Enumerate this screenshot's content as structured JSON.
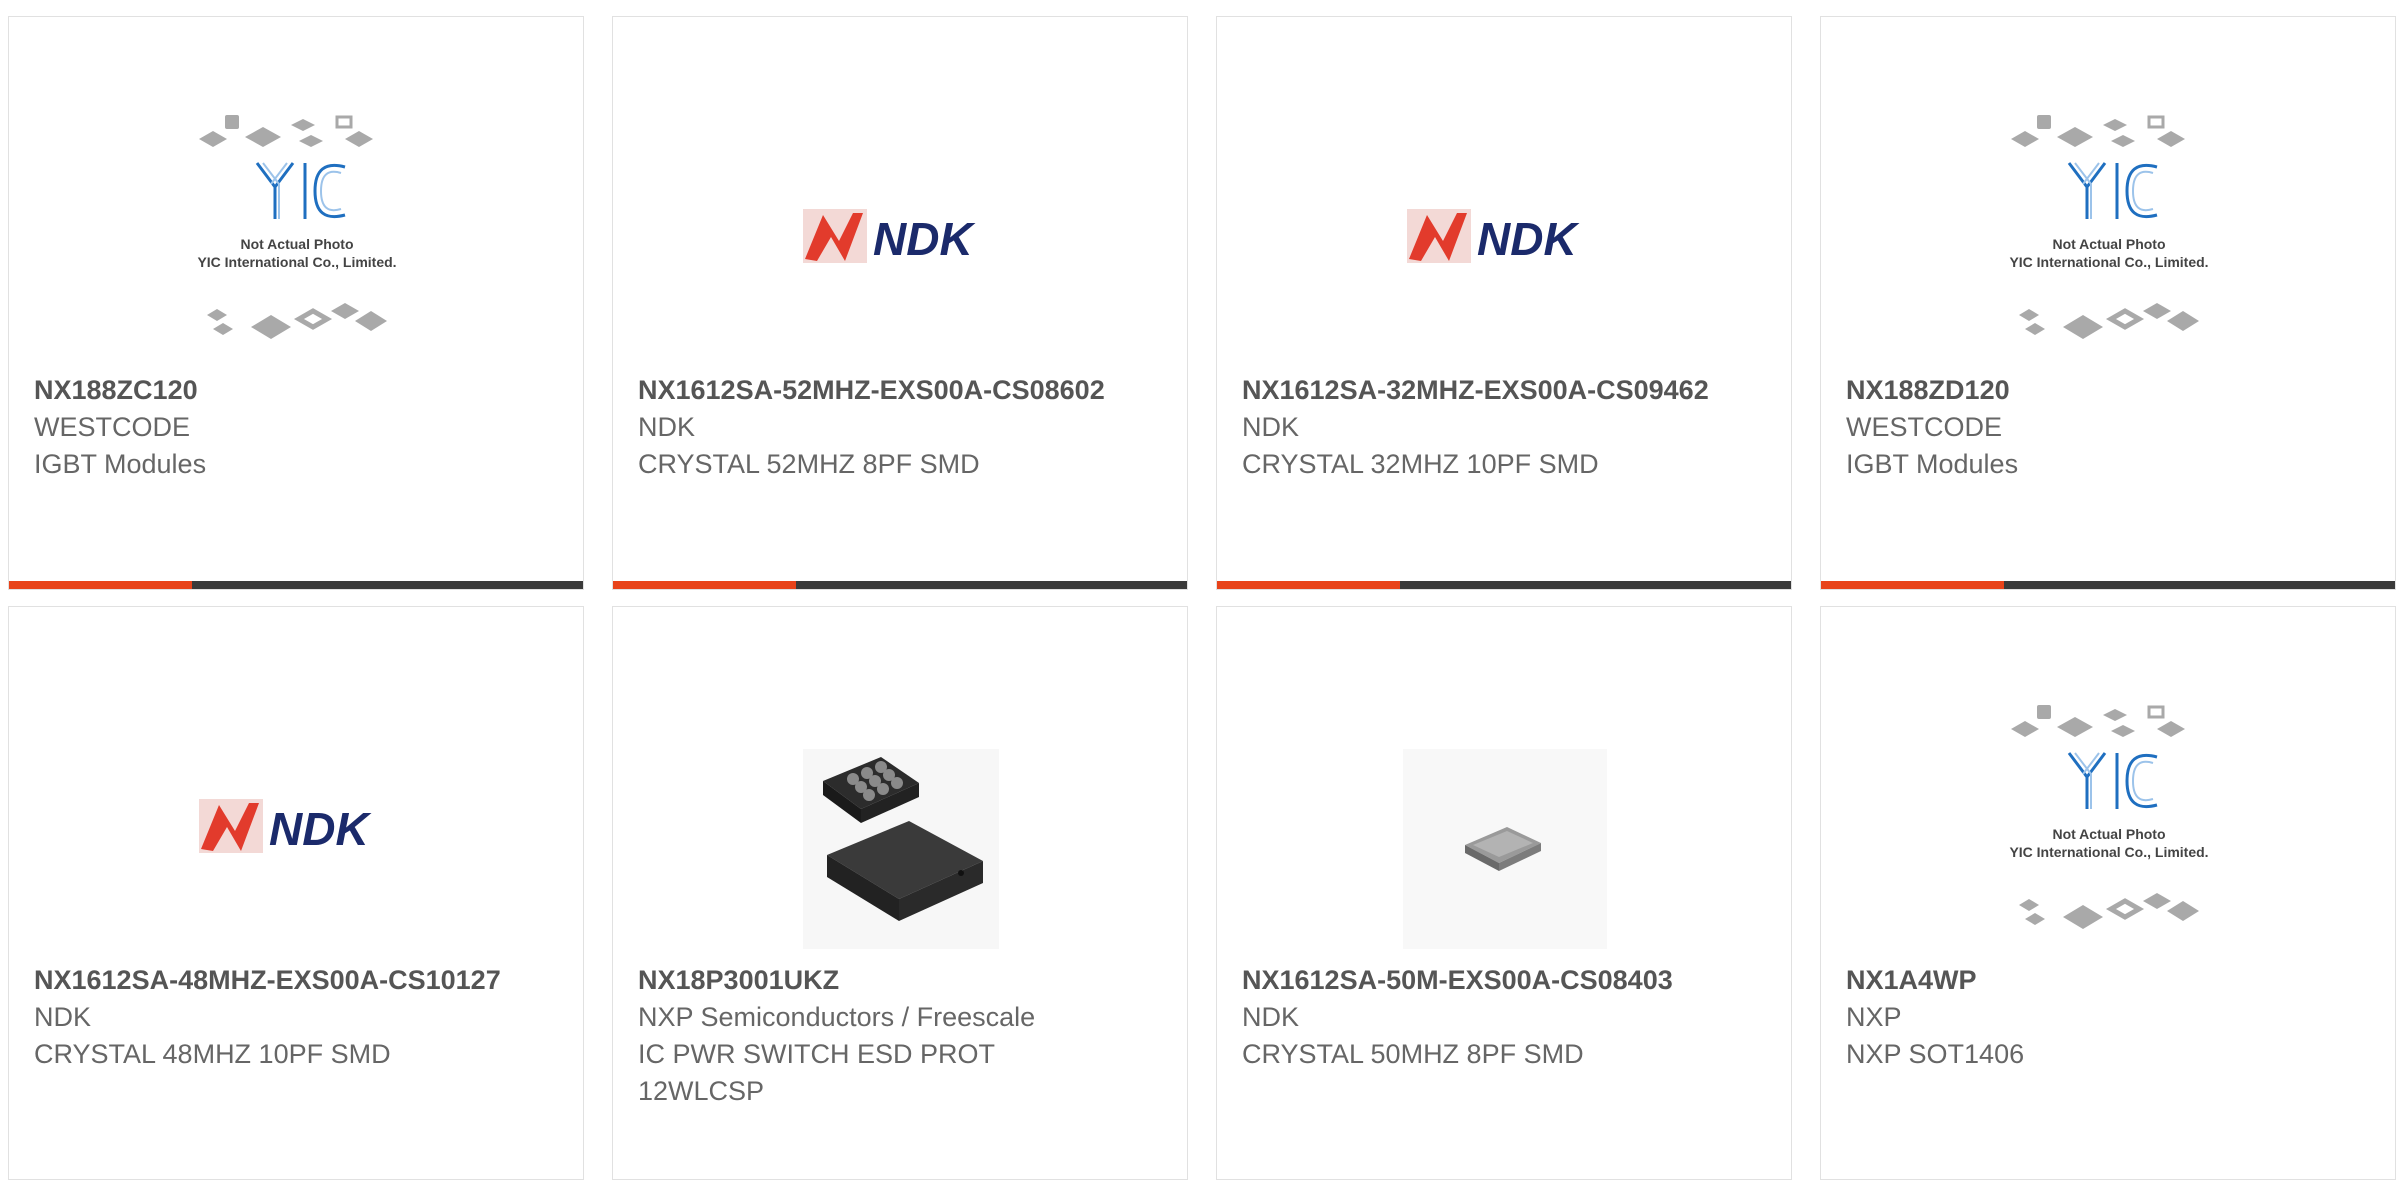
{
  "colors": {
    "accent": "#e8431a",
    "bar": "#3a3a3a",
    "border": "#e1e1e1",
    "text": "#555555",
    "ndk_red": "#e23b2c",
    "ndk_navy": "#1b2a6b",
    "yic_blue": "#1f6fc0"
  },
  "placeholder": {
    "line1": "Not Actual Photo",
    "line2": "YIC International Co., Limited.",
    "logo": "YIC"
  },
  "products": [
    {
      "part_number": "NX188ZC120",
      "manufacturer": "WESTCODE",
      "description": "IGBT Modules",
      "image": "yic-placeholder-image"
    },
    {
      "part_number": "NX1612SA-52MHZ-EXS00A-CS08602",
      "manufacturer": "NDK",
      "description": "CRYSTAL 52MHZ 8PF SMD",
      "image": "ndk-logo-image"
    },
    {
      "part_number": "NX1612SA-32MHZ-EXS00A-CS09462",
      "manufacturer": "NDK",
      "description": "CRYSTAL 32MHZ 10PF SMD",
      "image": "ndk-logo-image"
    },
    {
      "part_number": "NX188ZD120",
      "manufacturer": "WESTCODE",
      "description": "IGBT Modules",
      "image": "yic-placeholder-image"
    },
    {
      "part_number": "NX1612SA-48MHZ-EXS00A-CS10127",
      "manufacturer": "NDK",
      "description": "CRYSTAL 48MHZ 10PF SMD",
      "image": "ndk-logo-image"
    },
    {
      "part_number": "NX18P3001UKZ",
      "manufacturer": "NXP Semiconductors / Freescale",
      "description": "IC PWR SWITCH ESD PROT 12WLCSP",
      "image": "wlcsp-chip-photo"
    },
    {
      "part_number": "NX1612SA-50M-EXS00A-CS08403",
      "manufacturer": "NDK",
      "description": "CRYSTAL 50MHZ 8PF SMD",
      "image": "crystal-chip-photo"
    },
    {
      "part_number": "NX1A4WP",
      "manufacturer": "NXP",
      "description": "NXP SOT1406",
      "image": "yic-placeholder-image"
    }
  ]
}
